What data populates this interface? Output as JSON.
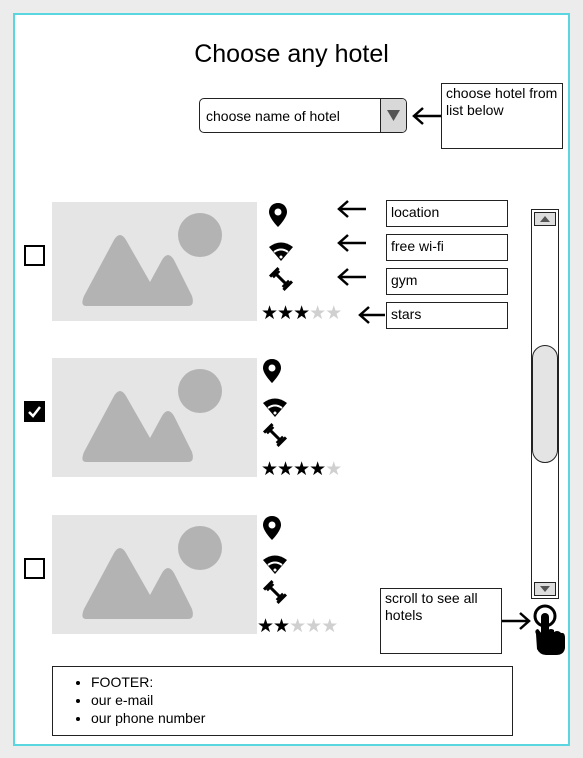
{
  "title": "Choose any hotel",
  "dropdown": {
    "value": "choose name of hotel"
  },
  "notes": {
    "choose_hotel": "choose hotel from list below",
    "scroll": "scroll to see all hotels"
  },
  "legend": {
    "location": "location",
    "wifi": "free wi-fi",
    "gym": "gym",
    "stars": "stars"
  },
  "hotels": [
    {
      "checked": false,
      "stars": 3,
      "max_stars": 5
    },
    {
      "checked": true,
      "stars": 4,
      "max_stars": 5
    },
    {
      "checked": false,
      "stars": 2,
      "max_stars": 5
    }
  ],
  "footer": {
    "items": [
      "FOOTER:",
      "our e-mail",
      "our phone number"
    ]
  },
  "colors": {
    "frame_border": "#5ad6e0",
    "placeholder_bg": "#e5e5e5",
    "placeholder_shape": "#b3b3b3",
    "star_off": "#d0d0d0"
  }
}
